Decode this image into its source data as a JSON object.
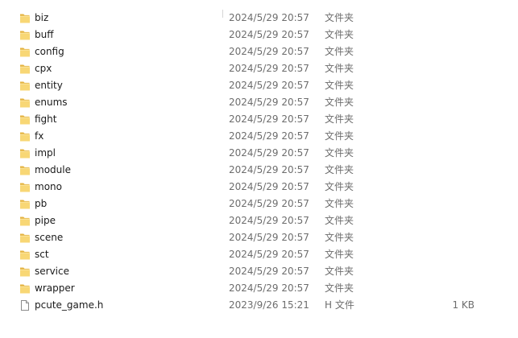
{
  "files": [
    {
      "name": "biz",
      "modified": "2024/5/29 20:57",
      "type": "文件夹",
      "size": "",
      "icon": "folder-icon"
    },
    {
      "name": "buff",
      "modified": "2024/5/29 20:57",
      "type": "文件夹",
      "size": "",
      "icon": "folder-icon"
    },
    {
      "name": "config",
      "modified": "2024/5/29 20:57",
      "type": "文件夹",
      "size": "",
      "icon": "folder-icon"
    },
    {
      "name": "cpx",
      "modified": "2024/5/29 20:57",
      "type": "文件夹",
      "size": "",
      "icon": "folder-icon"
    },
    {
      "name": "entity",
      "modified": "2024/5/29 20:57",
      "type": "文件夹",
      "size": "",
      "icon": "folder-icon"
    },
    {
      "name": "enums",
      "modified": "2024/5/29 20:57",
      "type": "文件夹",
      "size": "",
      "icon": "folder-icon"
    },
    {
      "name": "fight",
      "modified": "2024/5/29 20:57",
      "type": "文件夹",
      "size": "",
      "icon": "folder-icon"
    },
    {
      "name": "fx",
      "modified": "2024/5/29 20:57",
      "type": "文件夹",
      "size": "",
      "icon": "folder-icon"
    },
    {
      "name": "impl",
      "modified": "2024/5/29 20:57",
      "type": "文件夹",
      "size": "",
      "icon": "folder-icon"
    },
    {
      "name": "module",
      "modified": "2024/5/29 20:57",
      "type": "文件夹",
      "size": "",
      "icon": "folder-icon"
    },
    {
      "name": "mono",
      "modified": "2024/5/29 20:57",
      "type": "文件夹",
      "size": "",
      "icon": "folder-icon"
    },
    {
      "name": "pb",
      "modified": "2024/5/29 20:57",
      "type": "文件夹",
      "size": "",
      "icon": "folder-icon"
    },
    {
      "name": "pipe",
      "modified": "2024/5/29 20:57",
      "type": "文件夹",
      "size": "",
      "icon": "folder-icon"
    },
    {
      "name": "scene",
      "modified": "2024/5/29 20:57",
      "type": "文件夹",
      "size": "",
      "icon": "folder-icon"
    },
    {
      "name": "sct",
      "modified": "2024/5/29 20:57",
      "type": "文件夹",
      "size": "",
      "icon": "folder-icon"
    },
    {
      "name": "service",
      "modified": "2024/5/29 20:57",
      "type": "文件夹",
      "size": "",
      "icon": "folder-icon"
    },
    {
      "name": "wrapper",
      "modified": "2024/5/29 20:57",
      "type": "文件夹",
      "size": "",
      "icon": "folder-icon"
    },
    {
      "name": "pcute_game.h",
      "modified": "2023/9/26 15:21",
      "type": "H 文件",
      "size": "1 KB",
      "icon": "file-icon"
    }
  ],
  "colors": {
    "text": "#1a1a1a",
    "meta_text": "#6d6d6d",
    "folder_front": "#f8d775",
    "folder_back": "#e4b340",
    "background": "#ffffff"
  }
}
